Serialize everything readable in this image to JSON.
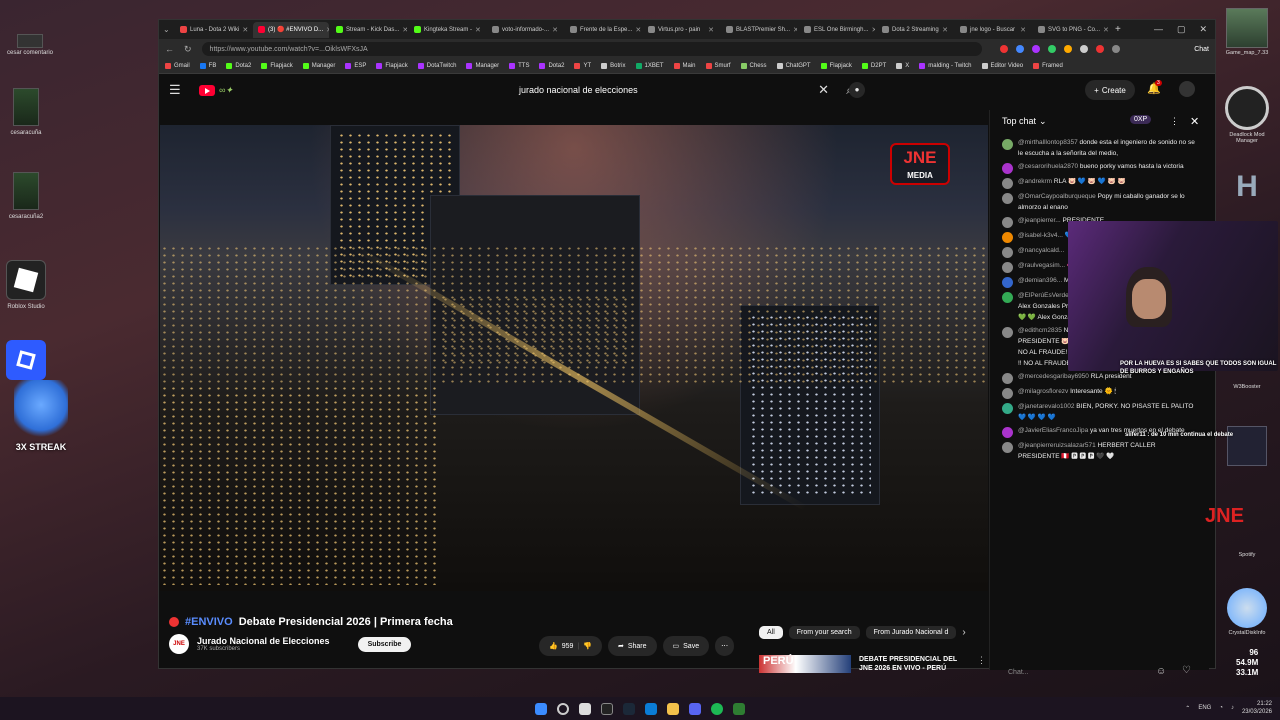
{
  "desktop": {
    "left_icons": [
      {
        "label": "cesar comentario"
      },
      {
        "label": "cesaracuña"
      },
      {
        "label": "cesaracuña2"
      },
      {
        "label": "Roblox Studio"
      },
      {
        "label": "Roblox Player"
      }
    ],
    "streak": "3X STREAK",
    "right_icons": [
      {
        "label": "Game_map_7.33"
      },
      {
        "label": "Deadlock Mod Manager"
      },
      {
        "label": "W3Booster"
      },
      {
        "label": "Spotify"
      },
      {
        "label": "CrystalDiskInfo"
      }
    ],
    "right_stats": {
      "fps": "96",
      "mem1": "54.9M",
      "mem2": "33.1M"
    }
  },
  "browser": {
    "tabs": [
      {
        "title": "Luna - Dota 2 Wiki",
        "color": "#e44"
      },
      {
        "title": "(3) 🔴 #ENVIVO D...",
        "color": "#f03",
        "active": true
      },
      {
        "title": "Stream - Kick Das...",
        "color": "#53fc18"
      },
      {
        "title": "Kingteka Stream -",
        "color": "#53fc18"
      },
      {
        "title": "voto-informado-...",
        "color": "#888"
      },
      {
        "title": "Frente de la Espe...",
        "color": "#888"
      },
      {
        "title": "Virtus.pro - pain",
        "color": "#888"
      },
      {
        "title": "BLASTPremier Sh...",
        "color": "#888"
      },
      {
        "title": "ESL One Birmingh...",
        "color": "#888"
      },
      {
        "title": "Dota 2 Streaming",
        "color": "#888"
      },
      {
        "title": "jne logo - Buscar",
        "color": "#888"
      },
      {
        "title": "SVG to PNG - Co...",
        "color": "#888"
      }
    ],
    "url": "https://www.youtube.com/watch?v=...OiklsWFXsJA",
    "chat_button": "Chat",
    "bookmarks": [
      {
        "label": "Gmail",
        "color": "#e44"
      },
      {
        "label": "FB",
        "color": "#1877f2"
      },
      {
        "label": "Dota2",
        "color": "#53fc18"
      },
      {
        "label": "Flapjack",
        "color": "#53fc18"
      },
      {
        "label": "Manager",
        "color": "#53fc18"
      },
      {
        "label": "ESP",
        "color": "#a3f"
      },
      {
        "label": "Flapjack",
        "color": "#a3f"
      },
      {
        "label": "DotaTwitch",
        "color": "#a3f"
      },
      {
        "label": "Manager",
        "color": "#a3f"
      },
      {
        "label": "TTS",
        "color": "#a3f"
      },
      {
        "label": "Dota2",
        "color": "#a3f"
      },
      {
        "label": "YT",
        "color": "#e44"
      },
      {
        "label": "Botrix",
        "color": "#ccc"
      },
      {
        "label": "1XBET",
        "color": "#1a6"
      },
      {
        "label": "Main",
        "color": "#e44"
      },
      {
        "label": "Smurf",
        "color": "#e44"
      },
      {
        "label": "Chess",
        "color": "#8c6"
      },
      {
        "label": "ChatGPT",
        "color": "#ccc"
      },
      {
        "label": "Flapjack",
        "color": "#53fc18"
      },
      {
        "label": "D2PT",
        "color": "#53fc18"
      },
      {
        "label": "X",
        "color": "#ccc"
      },
      {
        "label": "malding - Twitch",
        "color": "#a3f"
      },
      {
        "label": "Editor Video",
        "color": "#ccc"
      },
      {
        "label": "Framed",
        "color": "#e44"
      }
    ]
  },
  "youtube": {
    "search_query": "jurado nacional de elecciones",
    "create_label": "Create",
    "notification_count": "3",
    "video": {
      "overlay_logo": "JNE",
      "overlay_logo_sub": "MEDIA",
      "hashtag": "#ENVIVO",
      "title": "Debate Presidencial 2026 | Primera fecha",
      "channel": "Jurado Nacional de Elecciones",
      "channel_abbr": "JNE",
      "subscribers": "37K subscribers",
      "subscribe_label": "Subscribe",
      "likes": "959",
      "share_label": "Share",
      "save_label": "Save"
    },
    "filters": [
      "All",
      "From your search",
      "From Jurado Nacional d"
    ],
    "related": {
      "title": "DEBATE PRESIDENCIAL DEL JNE 2026 EN VIVO - PERÚ",
      "thumb_text": "PERÚ"
    }
  },
  "chat": {
    "header": "Top chat",
    "xp": "0XP",
    "input_placeholder": "Chat...",
    "messages": [
      {
        "author": "@mirthalllontop8357",
        "text": "donde esta el ingeniero de sonido no se le escucha a la señorita del medio,",
        "color": "#7a6"
      },
      {
        "author": "@cesarorihuela2870",
        "text": "bueno porky vamos hasta la victoria",
        "color": "#a3c"
      },
      {
        "author": "@andrekrm",
        "text": "RLA 🐷 💙 🐷 💙 🐷 🐷",
        "color": "#888"
      },
      {
        "author": "@OmarCaypoalburqueque",
        "text": "Popy mi caballo ganador se lo almorzo al enano",
        "color": "#888"
      },
      {
        "author": "@jeanpierrer...",
        "text": "PRESIDENTE",
        "color": "#888"
      },
      {
        "author": "@isabel-k3v4...",
        "text": "💙 💥 💙",
        "color": "#e80"
      },
      {
        "author": "@nancyalcald...",
        "text": "",
        "color": "#888"
      },
      {
        "author": "@raulvegasim...",
        "text": "👄 👄",
        "color": "#888"
      },
      {
        "author": "@demian396...",
        "text": "MILLONES EN CON 4000 MIL... MÁS",
        "color": "#36c"
      },
      {
        "author": "@ElPerúEsVerde",
        "text": "💚 💚 Alex Gonzales Presidente 💚 💚 Alex Gonzales Presidente 💚 💚 Alex Gonzales Presidente 💚 💚 Alex Gonzales Presidente 💚",
        "color": "#3a5"
      },
      {
        "author": "@edithcm2835",
        "text": "NO AL FRAUDE !! NO AL FRAUDE! PORKY PRESIDENTE 🐷 💙 NO AL FRAUDE !!! NO AL FRAUDE! NO AL FRAUDE! PORKY PRESIDENTE 🐷 NO AL FRAUDE !! NO AL FRAUDE! PORKY PRESIDENTE",
        "color": "#888"
      },
      {
        "author": "@mercedesgaribay6950",
        "text": "RLA president",
        "color": "#888"
      },
      {
        "author": "@milagrosflorezv",
        "text": "Interesante 🌞 🕯",
        "color": "#888"
      },
      {
        "author": "@janetarevalo1002",
        "text": "BIEN, PORKY. NO PISASTE EL PALITO 💙 💙 💙 💙",
        "color": "#3a8"
      },
      {
        "author": "@JavierEliasFrancoJipa",
        "text": "ya van tres muertos en el debate",
        "color": "#a3c"
      },
      {
        "author": "@jeanpierreruizsalazar571",
        "text": "HERBERT CALLER PRESIDENTE 🇵🇪 🅿 🅿 🅿 🖤 🤍",
        "color": "#888"
      }
    ]
  },
  "stream_overlay": {
    "text1": "POR LA HUEVA ES SI SABES QUE TODOS SON IGUAL DE BURROS Y ENGAÑOS",
    "text2": "slifer11 : de 10 min continua el debate",
    "jne": "JNE"
  },
  "taskbar": {
    "lang": "ENG",
    "time": "21:22",
    "date": "23/03/2026"
  }
}
